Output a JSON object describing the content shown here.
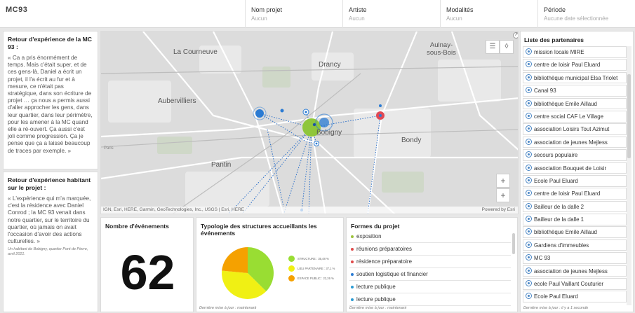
{
  "header": {
    "logo": "MC93",
    "filters": [
      {
        "label": "Nom projet",
        "value": "Aucun"
      },
      {
        "label": "Artiste",
        "value": "Aucun"
      },
      {
        "label": "Modalités",
        "value": "Aucun"
      },
      {
        "label": "Période",
        "value": "Aucune date sélectionnée"
      }
    ]
  },
  "left": {
    "card1": {
      "title": "Retour d'expérience de la MC 93 :",
      "body": "« Ca a pris énormément de temps. Mais c'était super, et de ces gens-là, Daniel a écrit un projet, il l'a écrit au fur et à mesure, ce n'était pas stratégique, dans son écriture de projet … ça nous a permis aussi d'aller approcher les gens, dans leur quartier, dans leur périmètre, pour les amener à la MC quand elle a ré-ouvert. Ça aussi c'est joli comme progression. Ça je pense que ça a laissé beaucoup de traces par exemple. »"
    },
    "card2": {
      "title": "Retour d'expérience habitant sur le projet :",
      "body": "« L'expérience qui m'a marquée, c'est la résidence avec Daniel Conrod ; la MC 93 venait dans notre quartier, sur le territoire du quartier, où jamais on avait l'occasion d'avoir des actions culturelles. »",
      "source": "Un habitant de Bobigny, quartier Pont de Pierre, avril 2021."
    }
  },
  "map": {
    "labels": [
      "La Courneuve",
      "Drancy",
      "Aulnay-sous-Bois",
      "Aubervilliers",
      "Bobigny",
      "Bondy",
      "Pantin",
      "Paris"
    ],
    "attribution": "IGN, Esri, HERE, Garmin, GeoTechnologies, Inc., USGS | Esri, HERE",
    "powered": "Powered by Esri",
    "zoom_in": "+",
    "zoom_out": "+",
    "icons": [
      "list-icon",
      "layers-icon",
      "expand-icon"
    ]
  },
  "count": {
    "title": "Nombre d'événements",
    "value": "62"
  },
  "typologie": {
    "title": "Typologie des structures accueillants les événements",
    "updated": "Dernière mise à jour : maintenant"
  },
  "chart_data": {
    "type": "pie",
    "title": "Typologie des structures accueillants les événements",
    "slices": [
      {
        "label": "STRUCTURE",
        "value": 35.48,
        "display": "STRUCTURE : 35,48 %",
        "color": "#99dd33"
      },
      {
        "label": "LIEU PARTENAIRE",
        "value": 37.1,
        "display": "LIEU PARTENAIRE : 37,1 %",
        "color": "#f0f014"
      },
      {
        "label": "ESPACE PUBLIC",
        "value": 22.26,
        "display": "ESPACE PUBLIC : 22,26 %",
        "color": "#f5a100"
      }
    ]
  },
  "formes": {
    "title": "Formes du projet",
    "updated": "Dernière mise à jour : maintenant",
    "items": [
      {
        "label": "exposition",
        "color": "#9cc23b"
      },
      {
        "label": "réunions préparatoires",
        "color": "#e04a4a"
      },
      {
        "label": "résidence préparatoire",
        "color": "#e04a4a"
      },
      {
        "label": "soutien logistique et financier",
        "color": "#2b7bd3"
      },
      {
        "label": "lecture publique",
        "color": "#2b9bd3"
      },
      {
        "label": "lecture publique",
        "color": "#2b9bd3"
      }
    ]
  },
  "partners": {
    "title": "Liste des  partenaires",
    "updated": "Dernière mise à jour : il y a 1 seconde",
    "items": [
      "mission locale MIRE",
      "centre de loisir Paul Eluard",
      "bibliothèque municipal Elsa Triolet",
      "Canal 93",
      "bibliothèque Emile Aillaud",
      "centre social CAF Le Village",
      "association Loisirs Tout Azimut",
      "association de jeunes Mejless",
      "secours populaire",
      "association Bouquet de Loisir",
      "Ecole Paul Eluard",
      "centre de loisir Paul Eluard",
      "Bailleur de la dalle 2",
      "Bailleur de la dalle 1",
      "bibliothèque Emile Aillaud",
      "Gardiens d'immeubles",
      "MC 93",
      "association de jeunes Mejless",
      "ecole Paul Vaillant Couturier",
      "Ecole Paul Eluard"
    ]
  }
}
